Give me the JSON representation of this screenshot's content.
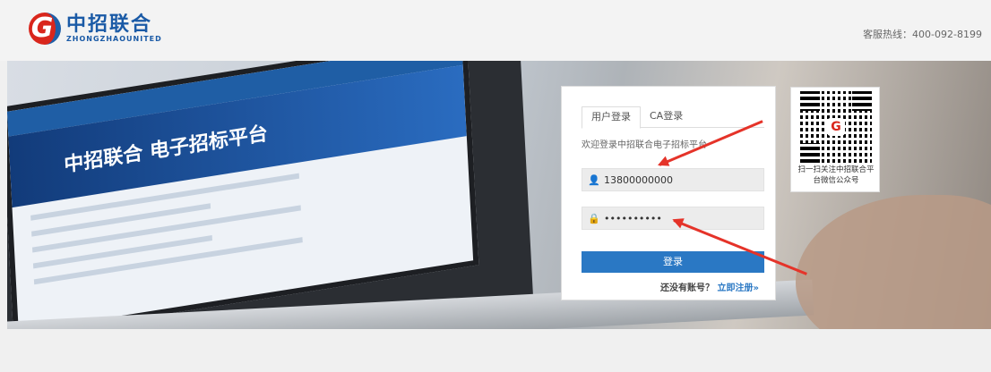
{
  "header": {
    "logo_glyph": "G",
    "logo_cn": "中招联合",
    "logo_en": "ZHONGZHAOUNITED",
    "hotline": "客服热线：400-092-8199"
  },
  "banner": {
    "screen_title": "中招联合 电子招标平台"
  },
  "login": {
    "tabs": [
      "用户登录",
      "CA登录"
    ],
    "welcome": "欢迎登录中招联合电子招标平台",
    "username_value": "13800000000",
    "password_value": "••••••••••",
    "submit_label": "登录",
    "no_account": "还没有账号？",
    "register_link": "立即注册»"
  },
  "qr": {
    "caption": "扫一扫关注中招联合平台微信公众号"
  },
  "colors": {
    "brand_blue": "#1a5aa6",
    "brand_red": "#d9261c",
    "button_blue": "#2a78c4",
    "arrow_red": "#e53329"
  }
}
